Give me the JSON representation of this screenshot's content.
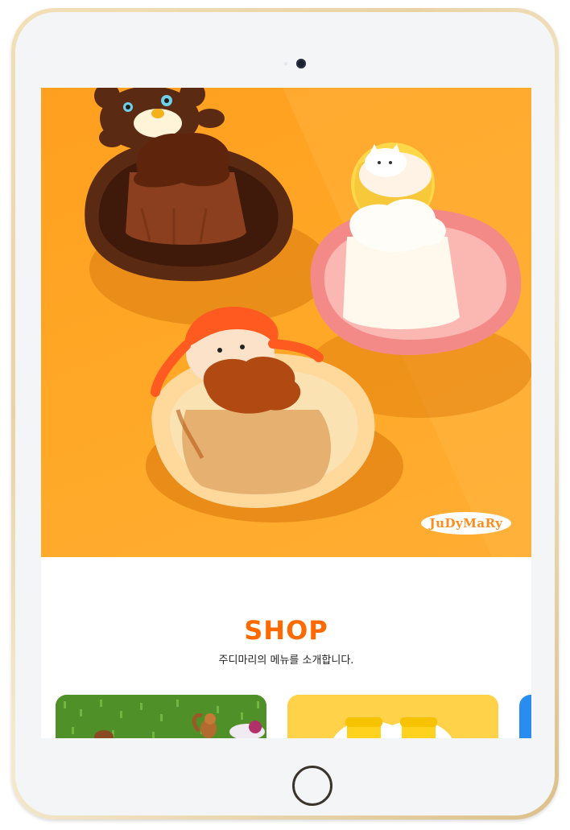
{
  "hero": {
    "brand_logo": "JuDyMaRy",
    "background_color": "#ffa428"
  },
  "shop": {
    "title": "SHOP",
    "subtitle": "주디마리의 메뉴를 소개합니다."
  },
  "colors": {
    "accent": "#ff6a00",
    "device_frame": "#e9d3a5",
    "card_green": "#5d9a2e",
    "card_yellow": "#ffd24a",
    "card_blue": "#2b8cf0"
  }
}
